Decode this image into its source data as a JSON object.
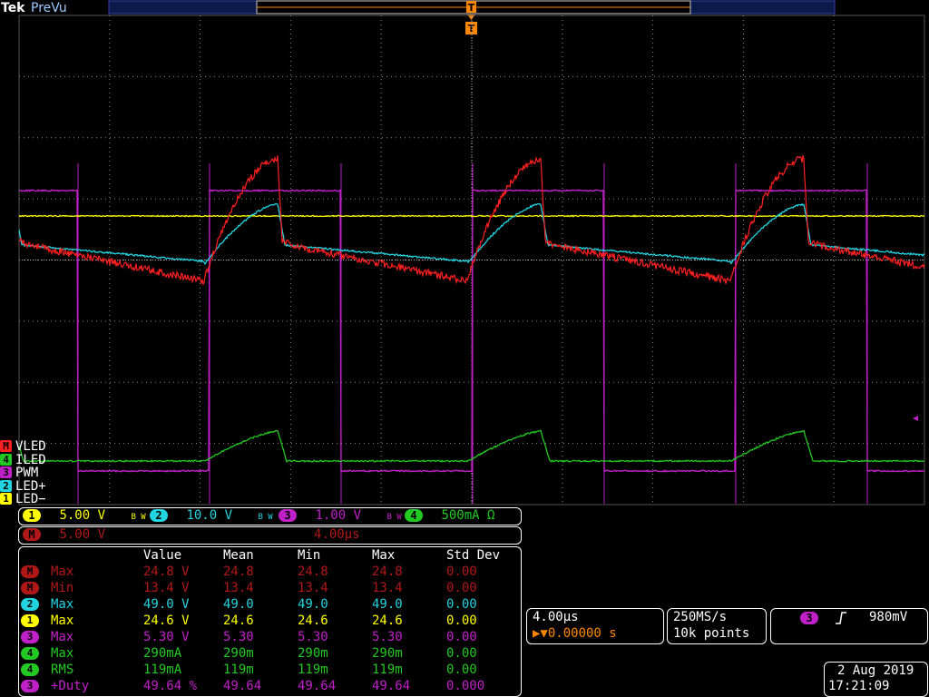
{
  "brand": {
    "logo": "Tek",
    "mode": "PreVu"
  },
  "trigger_marker": "T",
  "colors": {
    "ch1": "#ffff00",
    "ch2": "#22d3e0",
    "ch3": "#c020c8",
    "ch4": "#22c922",
    "math": "#ff2020",
    "grid": "#888888"
  },
  "channel_labels": [
    {
      "badge": "M",
      "name": "VLED",
      "color": "#ff2020"
    },
    {
      "badge": "4",
      "name": "ILED",
      "color": "#22c922"
    },
    {
      "badge": "3",
      "name": "PWM",
      "color": "#c020c8"
    },
    {
      "badge": "2",
      "name": "LED+",
      "color": "#22d3e0"
    },
    {
      "badge": "1",
      "name": "LED−",
      "color": "#ffff00"
    }
  ],
  "scale_bar": {
    "ch1": {
      "badge": "1",
      "value": "5.00 V",
      "bw": "B W"
    },
    "ch2": {
      "badge": "2",
      "value": "10.0 V",
      "bw": "B W"
    },
    "ch3": {
      "badge": "3",
      "value": "1.00 V",
      "bw": "B W"
    },
    "ch4": {
      "badge": "4",
      "value": "500mA Ω"
    },
    "math": {
      "badge": "M",
      "value": "5.00 V",
      "time": "4.00µs"
    }
  },
  "measurements": {
    "headers": [
      "Value",
      "Mean",
      "Min",
      "Max",
      "Std Dev"
    ],
    "rows": [
      {
        "badge": "M",
        "label": "Max",
        "color": "#ff2020",
        "values": [
          "24.8 V",
          "24.8",
          "24.8",
          "24.8",
          "0.00"
        ]
      },
      {
        "badge": "M",
        "label": "Min",
        "color": "#ff2020",
        "values": [
          "13.4 V",
          "13.4",
          "13.4",
          "13.4",
          "0.00"
        ]
      },
      {
        "badge": "2",
        "label": "Max",
        "color": "#22d3e0",
        "values": [
          "49.0 V",
          "49.0",
          "49.0",
          "49.0",
          "0.00"
        ]
      },
      {
        "badge": "1",
        "label": "Max",
        "color": "#ffff00",
        "values": [
          "24.6 V",
          "24.6",
          "24.6",
          "24.6",
          "0.00"
        ]
      },
      {
        "badge": "3",
        "label": "Max",
        "color": "#c020c8",
        "values": [
          "5.30 V",
          "5.30",
          "5.30",
          "5.30",
          "0.00"
        ]
      },
      {
        "badge": "4",
        "label": "Max",
        "color": "#22c922",
        "values": [
          "290mA",
          "290m",
          "290m",
          "290m",
          "0.00"
        ]
      },
      {
        "badge": "4",
        "label": "RMS",
        "color": "#22c922",
        "values": [
          "119mA",
          "119m",
          "119m",
          "119m",
          "0.00"
        ]
      },
      {
        "badge": "3",
        "label": "+Duty",
        "color": "#c020c8",
        "values": [
          "49.64 %",
          "49.64",
          "49.64",
          "49.64",
          "0.000"
        ]
      }
    ]
  },
  "timebase": {
    "scale": "4.00µs",
    "trigger_pos": "▶▼0.00000 s"
  },
  "acquisition": {
    "rate": "250MS/s",
    "points": "10k points"
  },
  "trigger": {
    "badge": "3",
    "slope": "rising",
    "level": "980mV"
  },
  "datetime": {
    "date": "2 Aug 2019",
    "time": "17:21:09"
  },
  "chart_data": {
    "type": "line",
    "x_unit": "µs",
    "x_per_div": 4.0,
    "divisions": {
      "x": 10,
      "y": 8
    },
    "period_us": 11.4,
    "series": [
      {
        "name": "VLED",
        "channel": "M",
        "values_summary": {
          "max_V": 24.8,
          "min_V": 13.4
        }
      },
      {
        "name": "LED+",
        "channel": "2",
        "values_summary": {
          "max_V": 49.0
        }
      },
      {
        "name": "LED−",
        "channel": "1",
        "values_summary": {
          "max_V": 24.6
        }
      },
      {
        "name": "PWM",
        "channel": "3",
        "values_summary": {
          "max_V": 5.3,
          "duty_pct": 49.64
        }
      },
      {
        "name": "ILED",
        "channel": "4",
        "values_summary": {
          "max_mA": 290,
          "rms_mA": 119
        }
      }
    ],
    "grid": true
  }
}
